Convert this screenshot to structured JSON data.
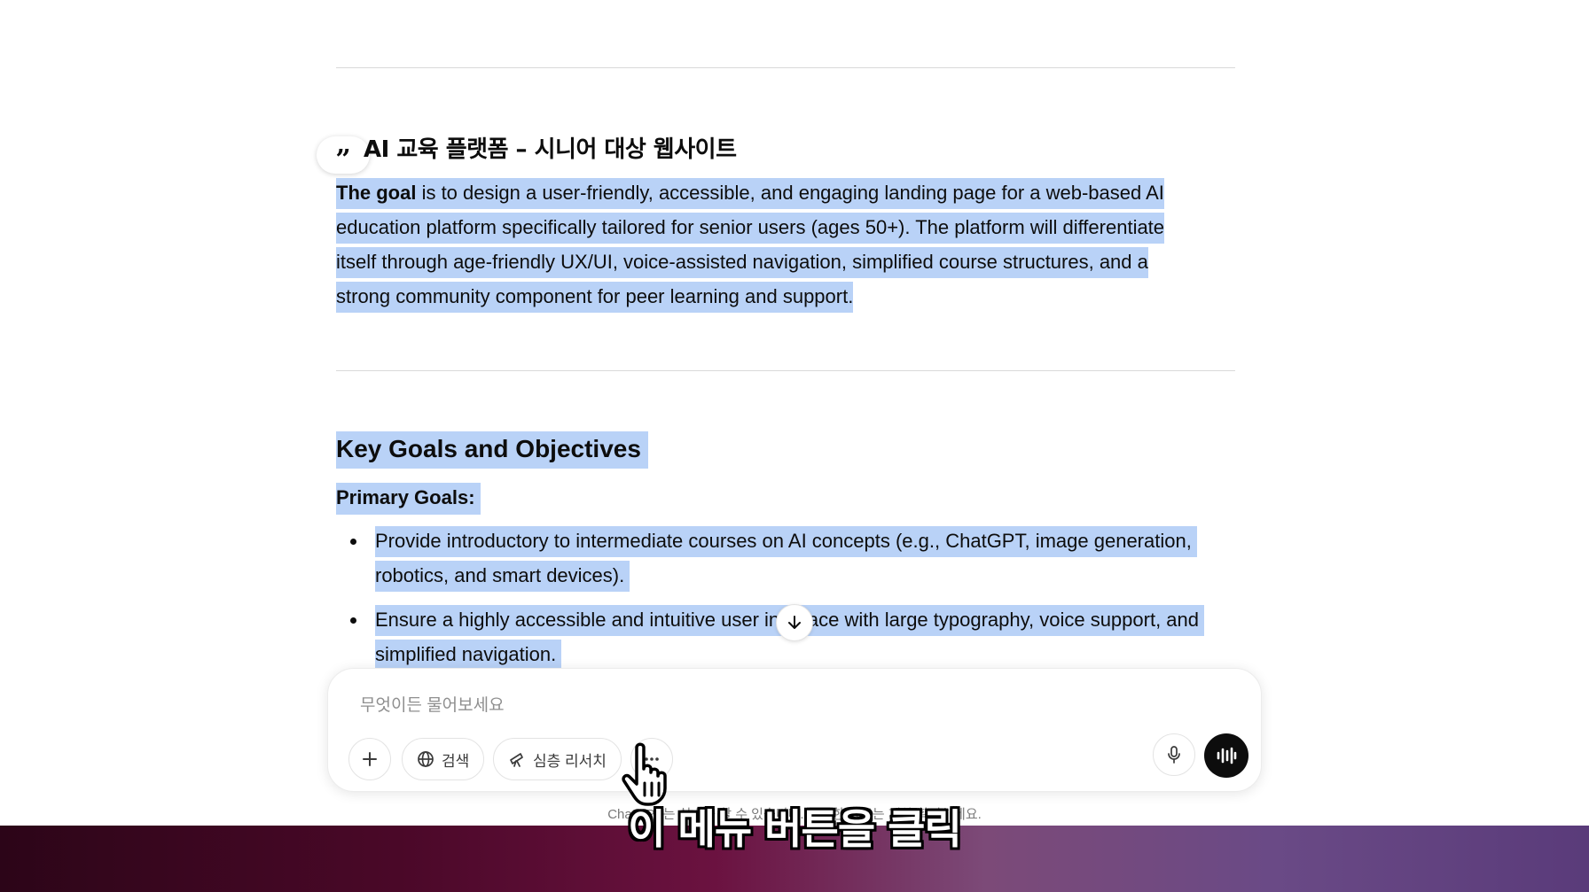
{
  "article": {
    "subtitle": "AI 교육 플랫폼 – 시니어 대상 웹사이트",
    "goal_lead": "The goal",
    "goal_rest": " is to design a user-friendly, accessible, and engaging landing page for a web-based AI education platform specifically tailored for senior users (ages 50+). The platform will differentiate itself through age-friendly UX/UI, voice-assisted navigation, simplified course structures, and a strong community component for peer learning and support.",
    "section_heading": "Key Goals and Objectives",
    "primary_goals_label": "Primary Goals:",
    "bullets": [
      "Provide introductory to intermediate courses on AI concepts (e.g., ChatGPT, image generation, robotics, and smart devices).",
      "Ensure a highly accessible and intuitive user interface with large typography, voice support, and simplified navigation."
    ]
  },
  "composer": {
    "placeholder": "무엇이든 물어보세요",
    "search_label": "검색",
    "deep_research_label": "심층 리서치"
  },
  "disclaimer": "ChatGPT는 실수를 할 수 있습니다. 중요한 정보는 재차 확인하세요.",
  "caption": "이 메뉴 버튼을 클릭",
  "colors": {
    "selection": "#b9d2f7",
    "accent_dark": "#0d0d0d"
  },
  "icons": [
    "quote-icon",
    "arrow-down-icon",
    "plus-icon",
    "globe-icon",
    "telescope-icon",
    "more-icon",
    "mic-icon",
    "voice-mode-icon",
    "hand-cursor-icon"
  ]
}
